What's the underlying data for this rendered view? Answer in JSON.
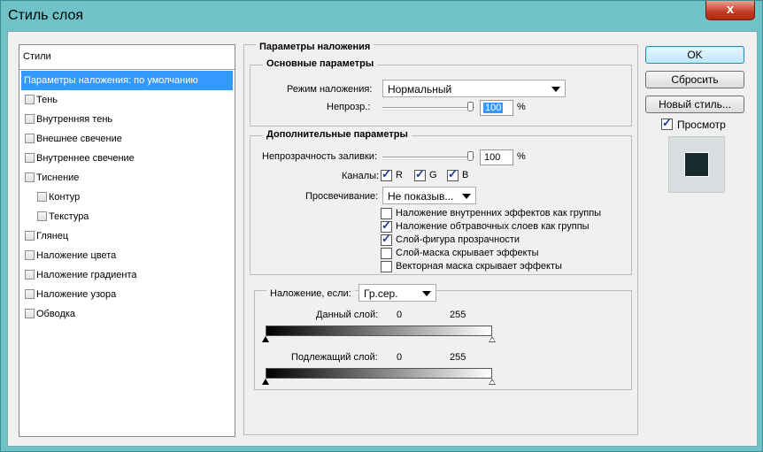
{
  "window": {
    "title": "Стиль слоя",
    "close_glyph": "x"
  },
  "styles_panel": {
    "header": "Стили",
    "items": [
      {
        "label": "Параметры наложения: по умолчанию",
        "selected": true,
        "checkbox": false
      },
      {
        "label": "Тень",
        "checkbox": true
      },
      {
        "label": "Внутренняя тень",
        "checkbox": true
      },
      {
        "label": "Внешнее свечение",
        "checkbox": true
      },
      {
        "label": "Внутреннее свечение",
        "checkbox": true
      },
      {
        "label": "Тиснение",
        "checkbox": true
      },
      {
        "label": "Контур",
        "checkbox": true,
        "indent": true
      },
      {
        "label": "Текстура",
        "checkbox": true,
        "indent": true
      },
      {
        "label": "Глянец",
        "checkbox": true
      },
      {
        "label": "Наложение цвета",
        "checkbox": true
      },
      {
        "label": "Наложение градиента",
        "checkbox": true
      },
      {
        "label": "Наложение узора",
        "checkbox": true
      },
      {
        "label": "Обводка",
        "checkbox": true
      }
    ]
  },
  "blending": {
    "title": "Параметры наложения",
    "basic": {
      "title": "Основные параметры",
      "mode_label": "Режим наложения:",
      "mode_value": "Нормальный",
      "opacity_label": "Непрозр.:",
      "opacity_value": "100",
      "opacity_unit": "%"
    },
    "advanced": {
      "title": "Дополнительные параметры",
      "fill_label": "Непрозрачность заливки:",
      "fill_value": "100",
      "fill_unit": "%",
      "channels_label": "Каналы:",
      "channels": [
        {
          "label": "R",
          "checked": true
        },
        {
          "label": "G",
          "checked": true
        },
        {
          "label": "B",
          "checked": true
        }
      ],
      "knockout_label": "Просвечивание:",
      "knockout_value": "Не показыв...",
      "options": [
        {
          "label": "Наложение внутренних эффектов как группы",
          "checked": false
        },
        {
          "label": "Наложение обтравочных слоев как группы",
          "checked": true
        },
        {
          "label": "Слой-фигура прозрачности",
          "checked": true
        },
        {
          "label": "Слой-маска скрывает эффекты",
          "checked": false
        },
        {
          "label": "Векторная маска скрывает эффекты",
          "checked": false
        }
      ]
    },
    "blend_if": {
      "label": "Наложение, если:",
      "value": "Гр.сер.",
      "this_layer_label": "Данный слой:",
      "this_layer_min": "0",
      "this_layer_max": "255",
      "underlying_label": "Подлежащий слой:",
      "underlying_min": "0",
      "underlying_max": "255"
    }
  },
  "buttons": {
    "ok": "OK",
    "reset": "Сбросить",
    "new_style": "Новый стиль..."
  },
  "preview": {
    "label": "Просмотр",
    "checked": true
  },
  "colors": {
    "titlebar": "#6fc3c8",
    "selection": "#3399ff",
    "close": "#c23a22",
    "swatch": "#172a2c"
  }
}
